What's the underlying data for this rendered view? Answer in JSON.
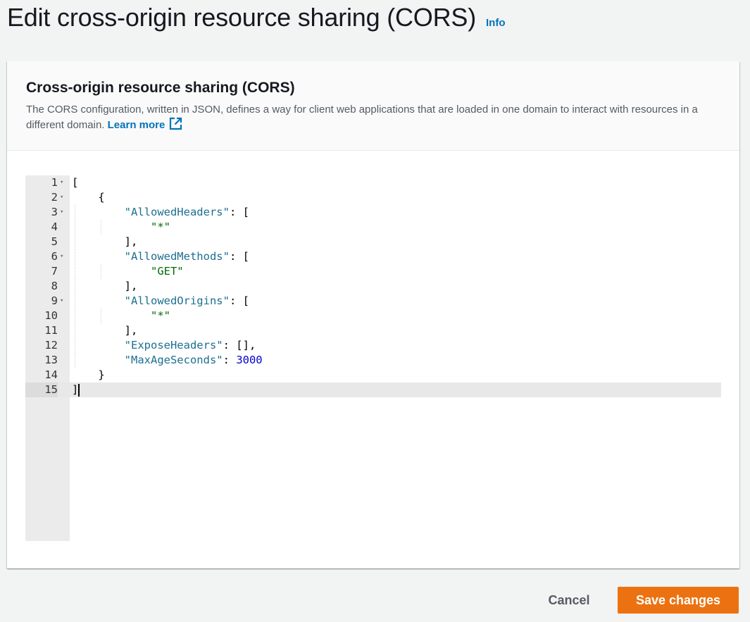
{
  "page": {
    "title": "Edit cross-origin resource sharing (CORS)",
    "info_label": "Info"
  },
  "panel": {
    "title": "Cross-origin resource sharing (CORS)",
    "description": "The CORS configuration, written in JSON, defines a way for client web applications that are loaded in one domain to interact with resources in a different domain.",
    "learn_more_label": "Learn more",
    "learn_more_icon": "external-link-icon"
  },
  "editor": {
    "language": "JSON",
    "active_line": 15,
    "lines": [
      {
        "number": "1",
        "text": "["
      },
      {
        "number": "2",
        "text": "    {"
      },
      {
        "number": "3",
        "text": "        \"AllowedHeaders\": ["
      },
      {
        "number": "4",
        "text": "            \"*\""
      },
      {
        "number": "5",
        "text": "        ],"
      },
      {
        "number": "6",
        "text": "        \"AllowedMethods\": ["
      },
      {
        "number": "7",
        "text": "            \"GET\""
      },
      {
        "number": "8",
        "text": "        ],"
      },
      {
        "number": "9",
        "text": "        \"AllowedOrigins\": ["
      },
      {
        "number": "10",
        "text": "            \"*\""
      },
      {
        "number": "11",
        "text": "        ],"
      },
      {
        "number": "12",
        "text": "        \"ExposeHeaders\": [],"
      },
      {
        "number": "13",
        "text": "        \"MaxAgeSeconds\": 3000"
      },
      {
        "number": "14",
        "text": "    }"
      },
      {
        "number": "15",
        "text": "]"
      }
    ],
    "foldable_lines": [
      1,
      2,
      3,
      6,
      9
    ]
  },
  "footer": {
    "cancel_label": "Cancel",
    "save_label": "Save changes"
  },
  "colors": {
    "primary_button": "#ec7211",
    "link": "#0073bb",
    "json_key": "#1d6f8f",
    "json_string": "#036a07",
    "json_number": "#0000cd"
  }
}
